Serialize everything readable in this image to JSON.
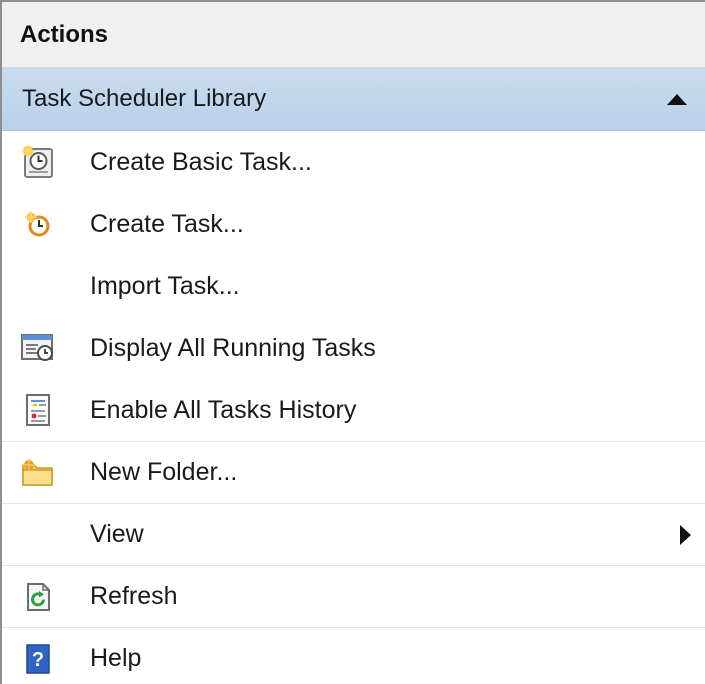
{
  "header": {
    "title": "Actions"
  },
  "section": {
    "title": "Task Scheduler Library"
  },
  "items": [
    {
      "label": "Create Basic Task...",
      "icon": "basic-task-clock-icon"
    },
    {
      "label": "Create Task...",
      "icon": "task-clock-icon"
    },
    {
      "label": "Import Task...",
      "icon": ""
    },
    {
      "label": "Display All Running Tasks",
      "icon": "running-tasks-icon"
    },
    {
      "label": "Enable All Tasks History",
      "icon": "tasks-history-icon"
    },
    {
      "label": "New Folder...",
      "icon": "new-folder-icon"
    },
    {
      "label": "View",
      "icon": "",
      "submenu": true
    },
    {
      "label": "Refresh",
      "icon": "refresh-icon"
    },
    {
      "label": "Help",
      "icon": "help-icon"
    }
  ],
  "colors": {
    "section_bg": "#b9d1ea",
    "header_bg": "#f0f0f0",
    "help_blue": "#2f63c4",
    "refresh_green": "#2ea043"
  }
}
